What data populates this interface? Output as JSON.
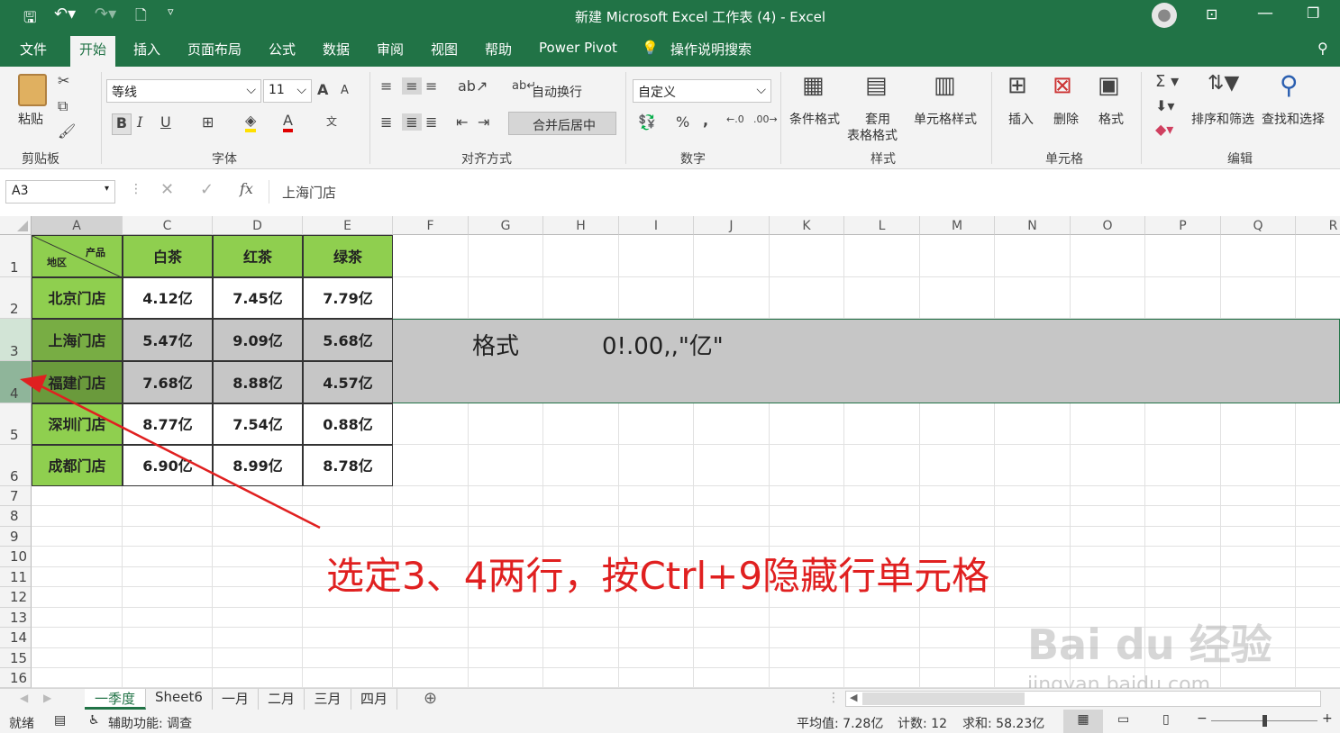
{
  "window": {
    "title": "新建 Microsoft Excel 工作表 (4)  -  Excel"
  },
  "tabs": [
    "文件",
    "开始",
    "插入",
    "页面布局",
    "公式",
    "数据",
    "审阅",
    "视图",
    "帮助",
    "Power Pivot",
    "操作说明搜索"
  ],
  "ribbon": {
    "clipboard": {
      "paste": "粘贴",
      "label": "剪贴板"
    },
    "font": {
      "name": "等线",
      "size": "11",
      "label": "字体",
      "bold": "B",
      "italic": "I",
      "underline": "U",
      "grow": "A",
      "shrink": "A"
    },
    "align": {
      "wrap": "自动换行",
      "merge": "合并后居中",
      "label": "对齐方式"
    },
    "number": {
      "format": "自定义",
      "label": "数字",
      "percent": "%",
      "comma": ","
    },
    "styles": {
      "cond": "条件格式",
      "table1": "套用",
      "table2": "表格格式",
      "cell": "单元格样式",
      "label": "样式"
    },
    "cells": {
      "insert": "插入",
      "delete": "删除",
      "format": "格式",
      "label": "单元格"
    },
    "edit": {
      "sort": "排序和筛选",
      "find": "查找和选择",
      "label": "编辑"
    }
  },
  "formula_bar": {
    "name_box": "A3",
    "fx": "fx",
    "content": "上海门店"
  },
  "columns": [
    "A",
    "C",
    "D",
    "E",
    "F",
    "G",
    "H",
    "I",
    "J",
    "K",
    "L",
    "M",
    "N",
    "O",
    "P",
    "Q",
    "R"
  ],
  "rows": [
    "1",
    "2",
    "3",
    "4",
    "5",
    "6",
    "7",
    "8",
    "9",
    "10",
    "11",
    "12",
    "13",
    "14",
    "15",
    "16"
  ],
  "table": {
    "corner_top": "产品",
    "corner_bottom": "地区",
    "headers": [
      "白茶",
      "红茶",
      "绿茶"
    ],
    "data": [
      {
        "region": "北京门店",
        "values": [
          "4.12亿",
          "7.45亿",
          "7.79亿"
        ]
      },
      {
        "region": "上海门店",
        "values": [
          "5.47亿",
          "9.09亿",
          "5.68亿"
        ]
      },
      {
        "region": "福建门店",
        "values": [
          "7.68亿",
          "8.88亿",
          "4.57亿"
        ]
      },
      {
        "region": "深圳门店",
        "values": [
          "8.77亿",
          "7.54亿",
          "0.88亿"
        ]
      },
      {
        "region": "成都门店",
        "values": [
          "6.90亿",
          "8.99亿",
          "8.78亿"
        ]
      }
    ]
  },
  "notes": {
    "format_label": "格式",
    "format_code": "0!.00,,\"亿\""
  },
  "annotation": "选定3、4两行，按Ctrl+9隐藏行单元格",
  "watermark": {
    "logo": "Bai du 经验",
    "url": "jingyan.baidu.com"
  },
  "sheets": [
    "一季度",
    "Sheet6",
    "一月",
    "二月",
    "三月",
    "四月"
  ],
  "status": {
    "ready": "就绪",
    "accessibility": "辅助功能: 调查",
    "avg": "平均值: 7.28亿",
    "count": "计数: 12",
    "sum": "求和: 58.23亿"
  },
  "colors": {
    "excel_green": "#217346",
    "cell_green": "#8fcf4f",
    "annotation_red": "#e02020"
  }
}
